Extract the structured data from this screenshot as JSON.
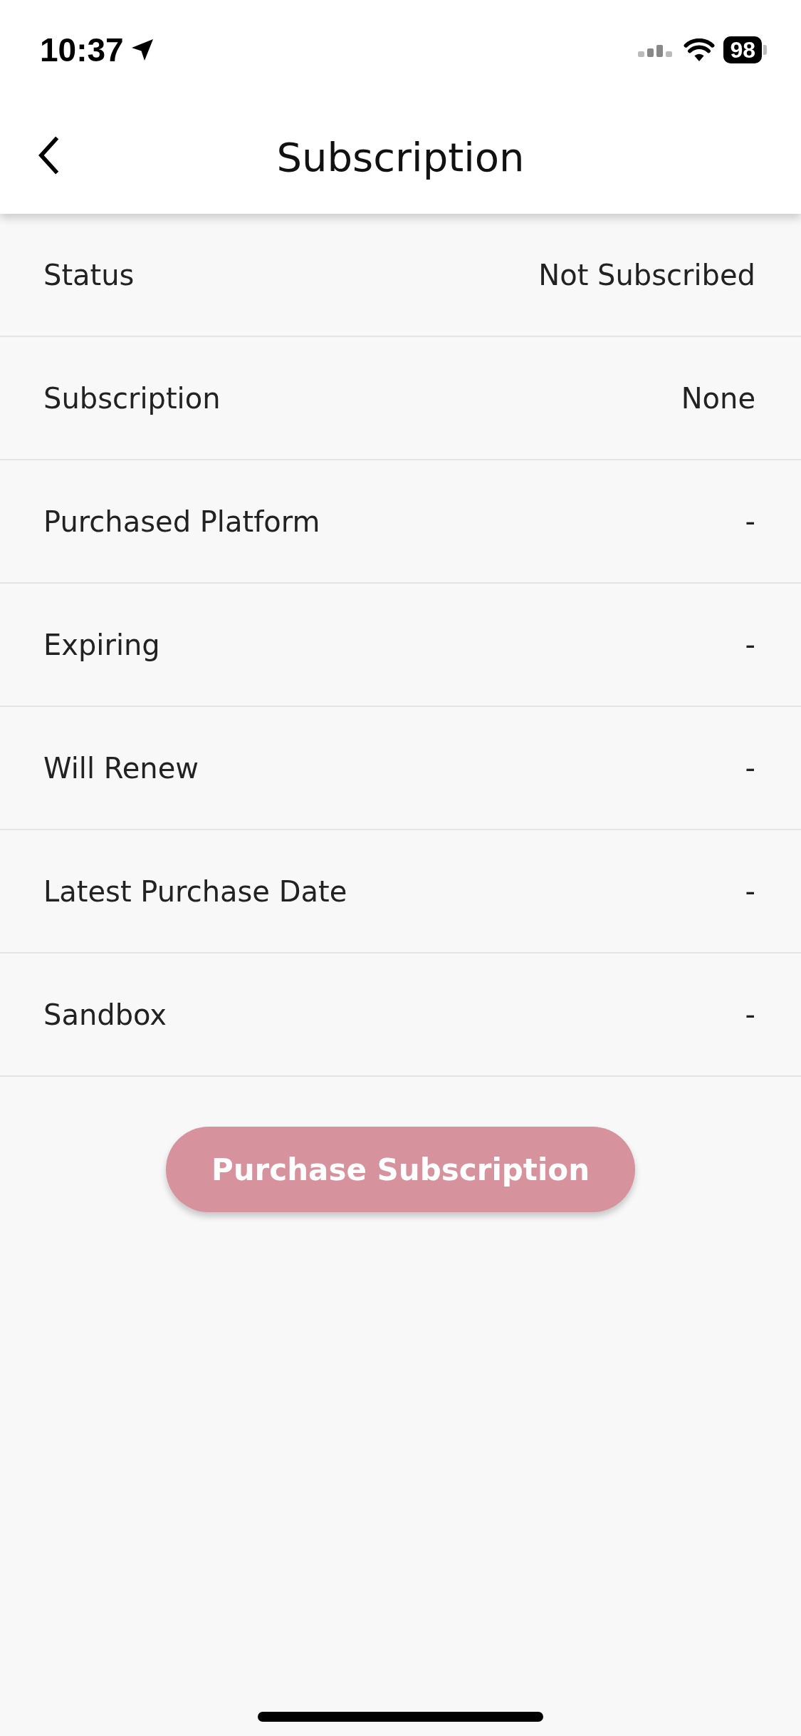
{
  "status_bar": {
    "time": "10:37",
    "battery": "98"
  },
  "nav_bar": {
    "title": "Subscription"
  },
  "rows": [
    {
      "label": "Status",
      "value": "Not Subscribed"
    },
    {
      "label": "Subscription",
      "value": "None"
    },
    {
      "label": "Purchased Platform",
      "value": "-"
    },
    {
      "label": "Expiring",
      "value": "-"
    },
    {
      "label": "Will Renew",
      "value": "-"
    },
    {
      "label": "Latest Purchase Date",
      "value": "-"
    },
    {
      "label": "Sandbox",
      "value": "-"
    }
  ],
  "purchase_button": {
    "label": "Purchase Subscription"
  }
}
